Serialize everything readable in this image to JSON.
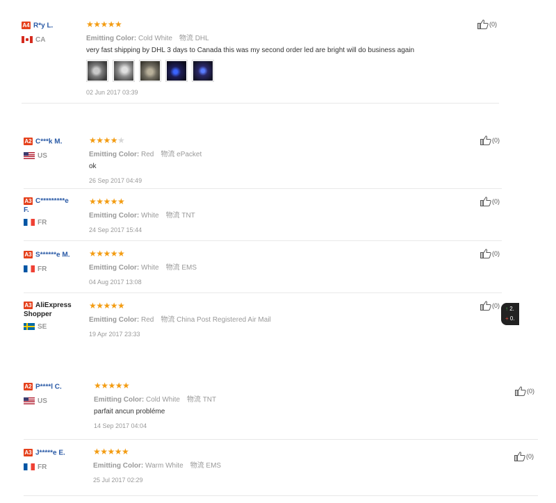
{
  "ui": {
    "color_label": "Emitting Color:",
    "ship_label": "物流",
    "star_full": "★",
    "star_empty": "★"
  },
  "reviews": [
    {
      "level": "A4",
      "name": "R*y L.",
      "country": "CA",
      "stars": 5,
      "color": "Cold White",
      "shipping": "DHL",
      "text": "very fast shipping by DHL 3 days to Canada this was my second order led are bright will do business again",
      "date": "02 Jun 2017 03:39",
      "likes": "(0)",
      "photos": 5
    },
    {
      "level": "A2",
      "name": "C***k M.",
      "country": "US",
      "stars": 4,
      "color": "Red",
      "shipping": "ePacket",
      "text": "ok",
      "date": "26 Sep 2017 04:49",
      "likes": "(0)"
    },
    {
      "level": "A3",
      "name": "C*********e F.",
      "name_line1": "C*********e",
      "name_line2": "F.",
      "country": "FR",
      "stars": 5,
      "color": "White",
      "shipping": "TNT",
      "text": "",
      "date": "24 Sep 2017 15:44",
      "likes": "(0)"
    },
    {
      "level": "A3",
      "name": "S******e M.",
      "country": "FR",
      "stars": 5,
      "color": "White",
      "shipping": "EMS",
      "text": "",
      "date": "04 Aug 2017 13:08",
      "likes": "(0)"
    },
    {
      "level": "A3",
      "name": "AliExpress Shopper",
      "name_line1": "AliExpress",
      "name_line2": "Shopper",
      "country": "SE",
      "stars": 5,
      "color": "Red",
      "shipping": "China Post Registered Air Mail",
      "text": "",
      "date": "19 Apr 2017 23:33",
      "likes": "(0)"
    },
    {
      "level": "A2",
      "name": "P****l C.",
      "country": "US",
      "stars": 5,
      "color": "Cold White",
      "shipping": "TNT",
      "text": "parfait ancun probléme",
      "date": "14 Sep 2017 04:04",
      "likes": "(0)"
    },
    {
      "level": "A3",
      "name": "J*****e E.",
      "country": "FR",
      "stars": 5,
      "color": "Warm White",
      "shipping": "EMS",
      "text": "",
      "date": "25 Jul 2017 02:29",
      "likes": "(0)"
    }
  ],
  "floating_widget": {
    "line1": "2.",
    "line2": "0."
  },
  "colors": {
    "level_badge": "#e5411c",
    "username": "#2a5aa6",
    "star": "#f39c12"
  }
}
